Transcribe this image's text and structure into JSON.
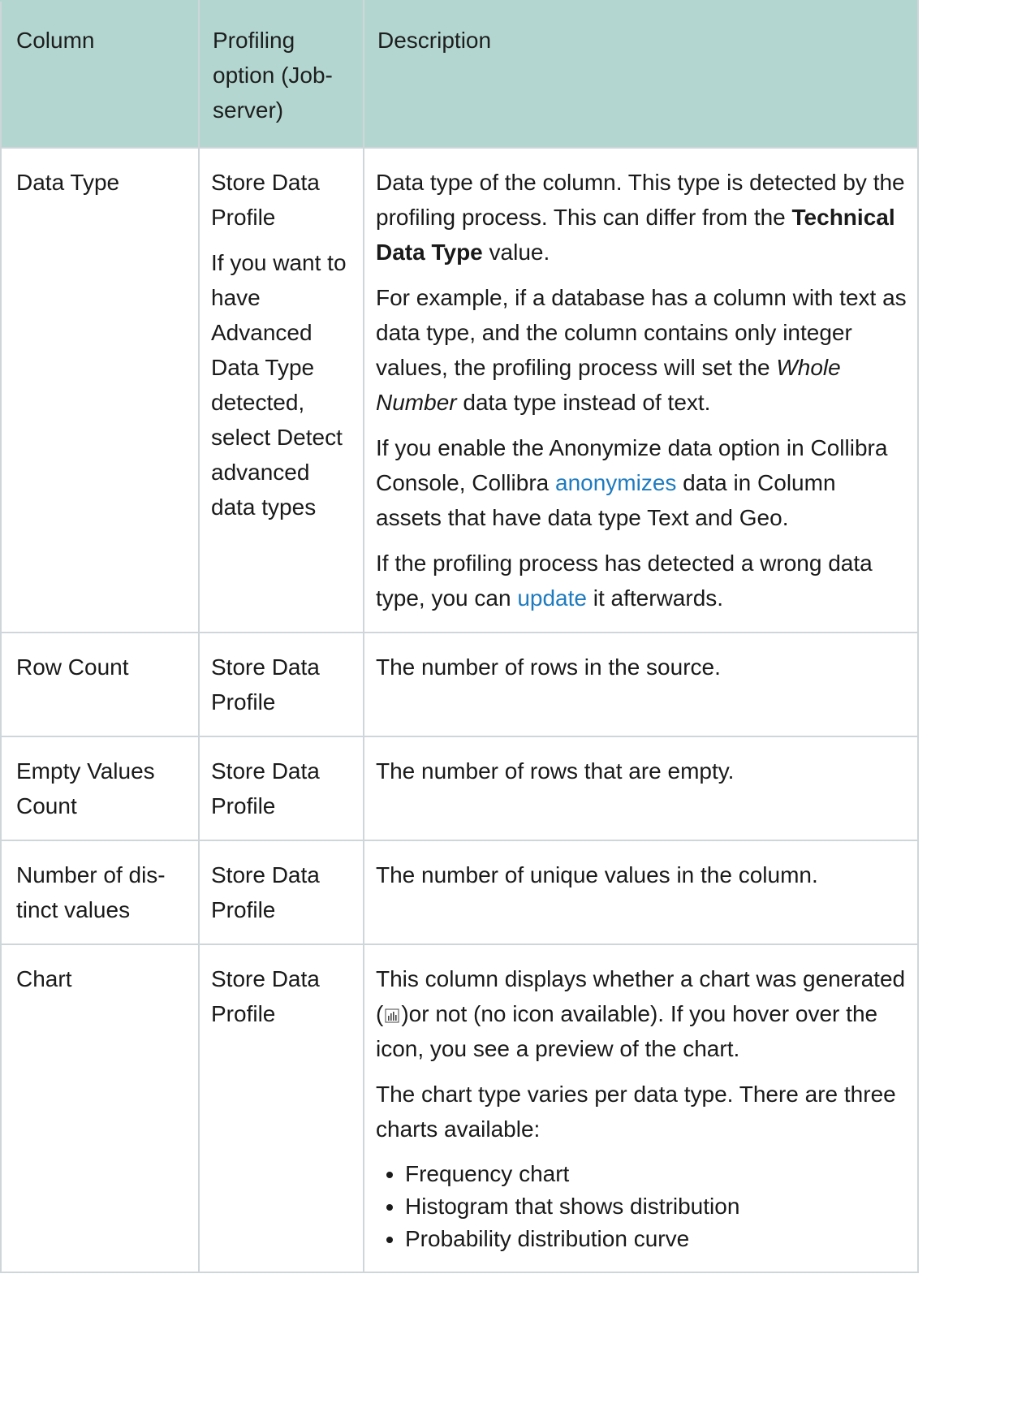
{
  "headers": {
    "column": "Column",
    "profiling_option": "Profiling option (Job-server)",
    "description": "Description"
  },
  "rows": {
    "data_type": {
      "column": "Data Type",
      "option_p1": "Store Data Profile",
      "option_p2": "If you want to have Advanced Data Type detected, select Detect advanced data types",
      "d1_a": "Data type of the column. This type is detected by the profiling process. This can differ from the ",
      "d1_b": "Technical Data Type",
      "d1_c": " value.",
      "d2_a": "For example, if a database has a column with text as data type, and the column contains only integer values, the profiling process will set the ",
      "d2_b": "Whole Number",
      "d2_c": " data type instead of text.",
      "d3_a": "If you enable the Anonymize data option in Collibra Console, Collibra ",
      "d3_link": "anonymizes",
      "d3_c": " data in Column assets that have data type Text and Geo.",
      "d4_a": "If the profiling process has detected a wrong data type, you can ",
      "d4_link": "update",
      "d4_c": " it afterwards."
    },
    "row_count": {
      "column": "Row Count",
      "option": "Store Data Profile",
      "description": "The number of rows in the source."
    },
    "empty_values": {
      "column": "Empty Values Count",
      "option": "Store Data Profile",
      "description": "The number of rows that are empty."
    },
    "distinct": {
      "column": "Number of dis-tinct values",
      "option": "Store Data Profile",
      "description": "The number of unique values in the column."
    },
    "chart": {
      "column": "Chart",
      "option": "Store Data Profile",
      "d1_a": "This column displays whether a chart was generated (",
      "d1_b": ")or not (no icon available). If you hover over the icon, you see a preview of the chart.",
      "d2": "The chart type varies per data type. There are three charts available:",
      "list": [
        "Frequency chart",
        "Histogram that shows distribution",
        "Probability distribution curve"
      ]
    }
  },
  "icons": {
    "chart_icon": "bar-chart-icon"
  },
  "colors": {
    "header_bg": "#b3d7d0",
    "link": "#1f7bbf",
    "border": "#cfd6da"
  }
}
